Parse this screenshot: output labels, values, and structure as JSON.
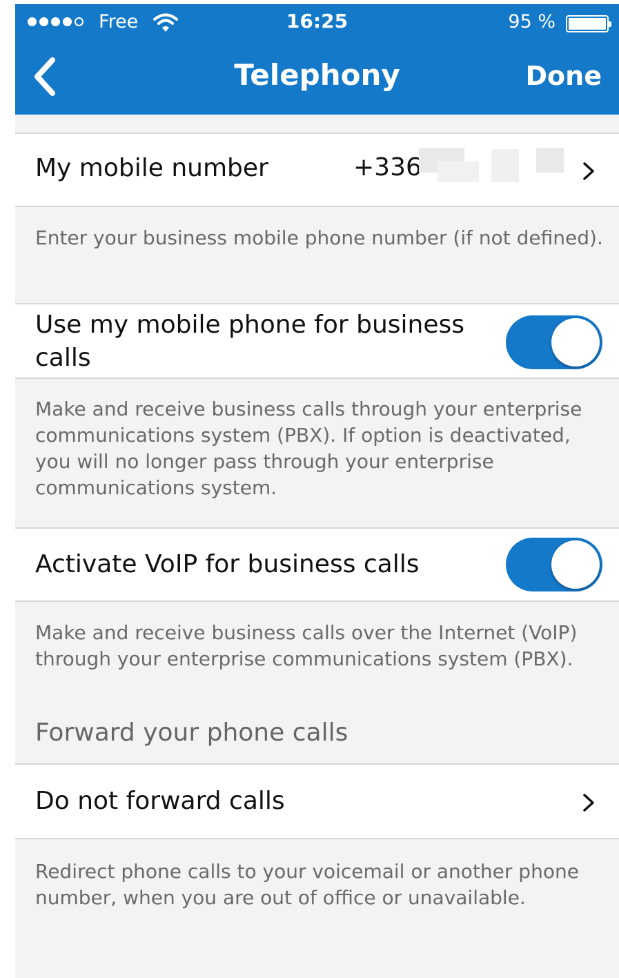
{
  "status_bar": {
    "carrier": "Free",
    "time": "16:25",
    "battery": "95 %",
    "signal_dots_filled": 4,
    "signal_dots_total": 5
  },
  "nav": {
    "title": "Telephony",
    "done_label": "Done",
    "back_icon": "chevron-left-icon"
  },
  "mobile_number": {
    "label": "My mobile number",
    "value": "+336",
    "description": "Enter your business mobile phone number (if not defined)."
  },
  "use_mobile": {
    "label_line1": "Use my mobile phone for business",
    "label_line2": "calls",
    "enabled": true,
    "description": "Make and receive business calls through your enterprise communications system (PBX). If option is deactivated, you will no longer pass through your enterprise communications system."
  },
  "voip": {
    "label": "Activate VoIP for business calls",
    "enabled": true,
    "description": "Make and receive business calls over the Internet (VoIP) through your enterprise communications system (PBX)."
  },
  "forwarding": {
    "section_title": "Forward your phone calls",
    "label": "Do not forward calls",
    "description": "Redirect phone calls to your voicemail or another phone number, when you are out of office or unavailable."
  },
  "colors": {
    "accent": "#1479c9",
    "background": "#f3f3f3"
  }
}
